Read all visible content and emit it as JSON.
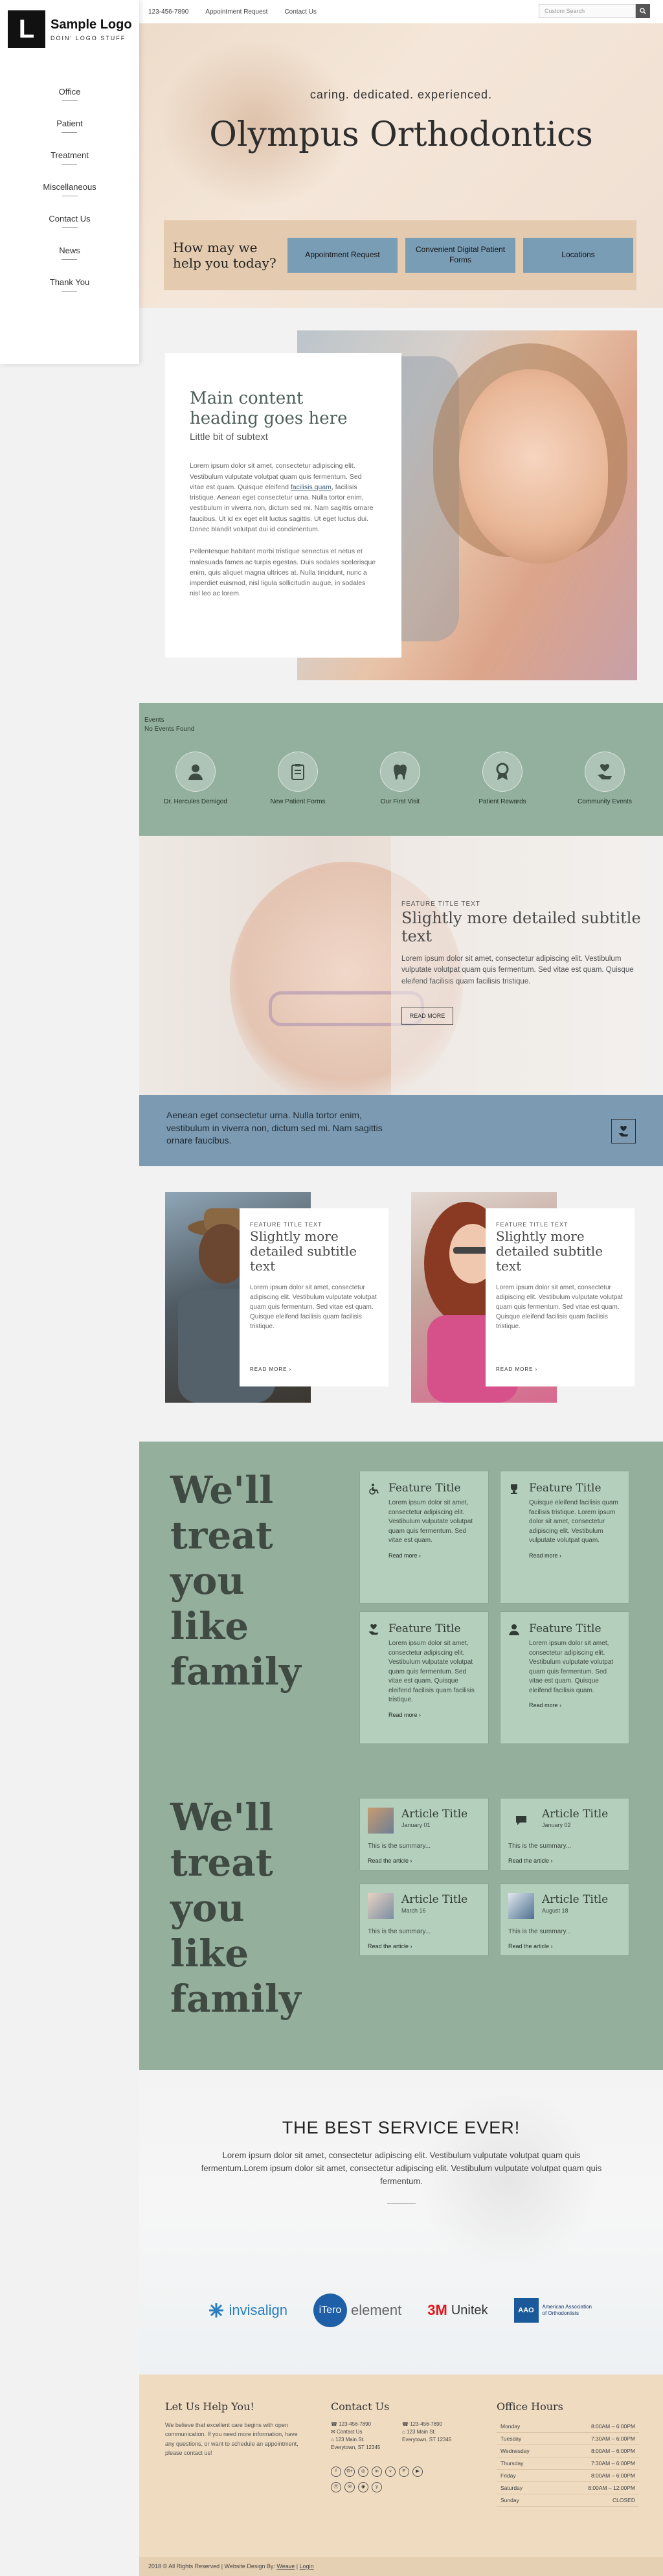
{
  "logo": {
    "title": "Sample Logo",
    "tagline": "DOIN' LOGO STUFF",
    "mark": "L"
  },
  "nav": [
    "Office",
    "Patient",
    "Treatment",
    "Miscellaneous",
    "Contact Us",
    "News",
    "Thank You"
  ],
  "topbar": {
    "phone": "123-456-7890",
    "links": [
      "Appointment Request",
      "Contact Us"
    ],
    "search_placeholder": "Custom Search"
  },
  "hero": {
    "tagline": "caring. dedicated. experienced.",
    "title": "Olympus Orthodontics",
    "help_text": "How may we help you today?",
    "buttons": [
      "Appointment Request",
      "Convenient Digital Patient Forms",
      "Locations"
    ]
  },
  "main": {
    "heading": "Main content heading goes here",
    "subtext": "Little bit of subtext",
    "para1_a": "Lorem ipsum dolor sit amet, consectetur adipiscing elit. Vestibulum vulputate volutpat quam quis fermentum. Sed vitae est quam. Quisque eleifend ",
    "para1_link": "facilisis quam",
    "para1_b": ", facilisis tristique. Aenean eget consectetur urna. Nulla tortor enim, vestibulum in viverra non, dictum sed mi. Nam sagittis ornare faucibus. Ut id ex eget elit luctus sagittis. Ut eget luctus dui. Donec blandit volutpat dui id condimentum.",
    "para2": "Pellentesque habitant morbi tristique senectus et netus et malesuada fames ac turpis egestas. Duis sodales scelerisque enim, quis aliquet magna ultrices at. Nulla tincidunt, nunc a imperdiet euismod, nisl ligula sollicitudin augue, in sodales nisl leo ac lorem."
  },
  "events": {
    "label": "Events",
    "none": "No Events Found",
    "items": [
      "Dr. Hercules Demigod",
      "New Patient Forms",
      "Our First Visit",
      "Patient Rewards",
      "Community Events"
    ]
  },
  "feature_band": {
    "kicker": "FEATURE TITLE TEXT",
    "title": "Slightly more detailed subtitle text",
    "body": "Lorem ipsum dolor sit amet, consectetur adipiscing elit. Vestibulum vulputate volutpat quam quis fermentum. Sed vitae est quam. Quisque eleifend facilisis quam facilisis tristique.",
    "cta": "READ MORE"
  },
  "blue_band": {
    "text": "Aenean eget consectetur urna. Nulla tortor enim, vestibulum in viverra non, dictum sed mi. Nam sagittis ornare faucibus."
  },
  "two_features": [
    {
      "kicker": "FEATURE TITLE TEXT",
      "title": "Slightly more detailed subtitle text",
      "body": "Lorem ipsum dolor sit amet, consectetur adipiscing elit. Vestibulum vulputate volutpat quam quis fermentum. Sed vitae est quam. Quisque eleifend facilisis quam facilisis tristique.",
      "cta": "READ MORE"
    },
    {
      "kicker": "FEATURE TITLE TEXT",
      "title": "Slightly more detailed subtitle text",
      "body": "Lorem ipsum dolor sit amet, consectetur adipiscing elit. Vestibulum vulputate volutpat quam quis fermentum. Sed vitae est quam. Quisque eleifend facilisis quam facilisis tristique.",
      "cta": "READ MORE"
    }
  ],
  "family": {
    "words": [
      "We'll",
      "treat",
      "you",
      "like",
      "family"
    ],
    "features": [
      {
        "title": "Feature Title",
        "text": "Lorem ipsum dolor sit amet, consectetur adipiscing elit. Vestibulum vulputate volutpat quam quis fermentum. Sed vitae est quam.",
        "cta": "Read more",
        "icon": "wheelchair-icon"
      },
      {
        "title": "Feature Title",
        "text": "Quisque eleifend facilisis quam facilisis tristique. Lorem ipsum dolor sit amet, consectetur adipiscing elit. Vestibulum vulputate volutpat quam.",
        "cta": "Read more",
        "icon": "trophy-icon"
      },
      {
        "title": "Feature Title",
        "text": "Lorem ipsum dolor sit amet, consectetur adipiscing elit. Vestibulum vulputate volutpat quam quis fermentum. Sed vitae est quam. Quisque eleifend facilisis quam facilisis tristique.",
        "cta": "Read more",
        "icon": "hand-tooth-icon"
      },
      {
        "title": "Feature Title",
        "text": "Lorem ipsum dolor sit amet, consectetur adipiscing elit. Vestibulum vulputate volutpat quam quis fermentum. Sed vitae est quam. Quisque eleifend facilisis quam.",
        "cta": "Read more",
        "icon": "person-icon"
      }
    ],
    "articles": [
      {
        "title": "Article Title",
        "date": "January 01",
        "summary": "This is the summary...",
        "cta": "Read the article"
      },
      {
        "title": "Article Title",
        "date": "January 02",
        "summary": "This is the summary...",
        "cta": "Read the article"
      },
      {
        "title": "Article Title",
        "date": "March 16",
        "summary": "This is the summary...",
        "cta": "Read the article"
      },
      {
        "title": "Article Title",
        "date": "August 18",
        "summary": "This is the summary...",
        "cta": "Read the article"
      }
    ]
  },
  "best": {
    "title": "THE BEST SERVICE EVER!",
    "body": "Lorem ipsum dolor sit amet, consectetur adipiscing elit. Vestibulum vulputate volutpat quam quis fermentum.Lorem ipsum dolor sit amet, consectetur adipiscing elit. Vestibulum vulputate volutpat quam quis fermentum.",
    "logos": [
      "invisalign",
      "iTero",
      "element",
      "3M",
      "Unitek",
      "AAO",
      "American Association of Orthodontists"
    ]
  },
  "footer": {
    "help_title": "Let Us Help You!",
    "help_text": "We believe that excellent care begins with open communication. If you need more information, have any questions, or want to schedule an appointment, please contact us!",
    "contact_title": "Contact Us",
    "phone1": "123-456-7890",
    "phone2": "123-456-7890",
    "contact_label": "Contact Us",
    "addr1": "123 Main St. Everytown, ST 12345",
    "addr2": "123 Main St. Everytown, ST 12345",
    "social": [
      "f",
      "G+",
      "◎",
      "in",
      "v",
      "P",
      "▶",
      "Ⓨ",
      "✉",
      "◉",
      "y"
    ],
    "hours_title": "Office Hours",
    "hours": [
      {
        "day": "Monday",
        "time": "8:00AM – 6:00PM"
      },
      {
        "day": "Tuesday",
        "time": "7:30AM – 6:00PM"
      },
      {
        "day": "Wednesday",
        "time": "8:00AM – 6:00PM"
      },
      {
        "day": "Thursday",
        "time": "7:30AM – 6:00PM"
      },
      {
        "day": "Friday",
        "time": "8:00AM – 6:00PM"
      },
      {
        "day": "Saturday",
        "time": "8:00AM – 12:00PM"
      },
      {
        "day": "Sunday",
        "time": "CLOSED"
      }
    ],
    "copyright": "2018 © All Rights Reserved | Website Design By:",
    "design_link": "Weave",
    "login": "Login"
  },
  "colors": {
    "sage": "#93b09e",
    "blue": "#7c9bb3",
    "beige": "#efdbc0",
    "help_btn": "#7a9db6"
  }
}
